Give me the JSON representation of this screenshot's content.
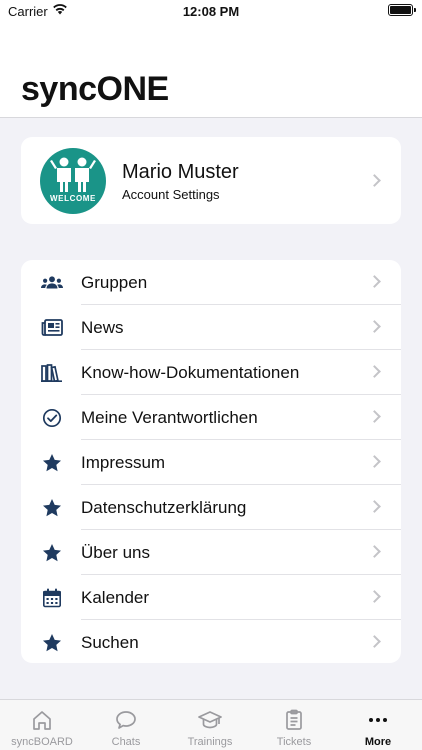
{
  "status_bar": {
    "carrier": "Carrier",
    "time": "12:08 PM"
  },
  "header": {
    "title": "syncONE"
  },
  "profile": {
    "name": "Mario Muster",
    "subtitle": "Account Settings",
    "avatar_text": "WELCOME",
    "avatar_color": "#1a9488"
  },
  "menu": {
    "items": [
      {
        "label": "Gruppen",
        "icon": "group-icon"
      },
      {
        "label": "News",
        "icon": "newspaper-icon"
      },
      {
        "label": "Know-how-Dokumentationen",
        "icon": "books-icon"
      },
      {
        "label": "Meine Verantwortlichen",
        "icon": "check-circle-icon"
      },
      {
        "label": "Impressum",
        "icon": "star-icon"
      },
      {
        "label": "Datenschutzerklärung",
        "icon": "star-icon"
      },
      {
        "label": "Über uns",
        "icon": "star-icon"
      },
      {
        "label": "Kalender",
        "icon": "calendar-icon"
      },
      {
        "label": "Suchen",
        "icon": "star-icon"
      }
    ]
  },
  "tabbar": {
    "tabs": [
      {
        "label": "syncBOARD",
        "icon": "home-icon"
      },
      {
        "label": "Chats",
        "icon": "chat-bubble-icon"
      },
      {
        "label": "Trainings",
        "icon": "graduation-cap-icon"
      },
      {
        "label": "Tickets",
        "icon": "clipboard-icon"
      },
      {
        "label": "More",
        "icon": "more-dots-icon"
      }
    ],
    "active": "More"
  },
  "colors": {
    "icon_navy": "#1f3a5f",
    "accent_teal": "#1a9488"
  }
}
